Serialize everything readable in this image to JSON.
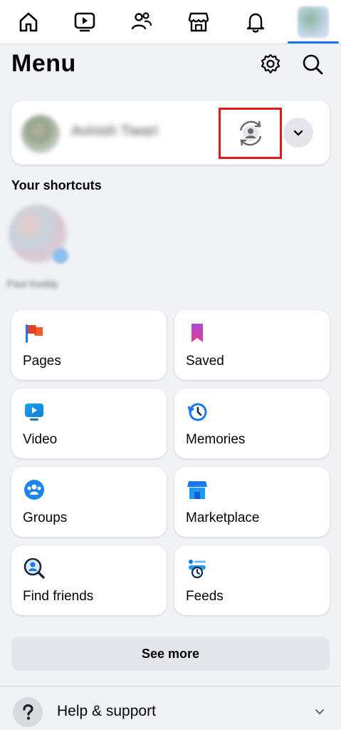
{
  "nav": {
    "icons": [
      "home-icon",
      "video-icon",
      "friends-icon",
      "marketplace-icon",
      "notifications-icon",
      "profile-menu-avatar"
    ],
    "active_index": 5,
    "accent": "#1877f2"
  },
  "header": {
    "title": "Menu",
    "icons": [
      "gear-icon",
      "search-icon"
    ]
  },
  "profile": {
    "name": "Avinish Tiwari",
    "highlight_color": "#e4181c"
  },
  "shortcuts": {
    "title": "Your shortcuts",
    "items": [
      {
        "label": "Paul Keddy"
      }
    ]
  },
  "tiles": [
    {
      "label": "Pages",
      "icon": "pages-flag-icon"
    },
    {
      "label": "Saved",
      "icon": "saved-bookmark-icon"
    },
    {
      "label": "Video",
      "icon": "video-icon"
    },
    {
      "label": "Memories",
      "icon": "memories-clock-icon"
    },
    {
      "label": "Groups",
      "icon": "groups-icon"
    },
    {
      "label": "Marketplace",
      "icon": "marketplace-icon"
    },
    {
      "label": "Find friends",
      "icon": "find-friends-icon"
    },
    {
      "label": "Feeds",
      "icon": "feeds-icon"
    }
  ],
  "see_more": "See more",
  "help": {
    "label": "Help & support",
    "icon": "question-icon"
  }
}
